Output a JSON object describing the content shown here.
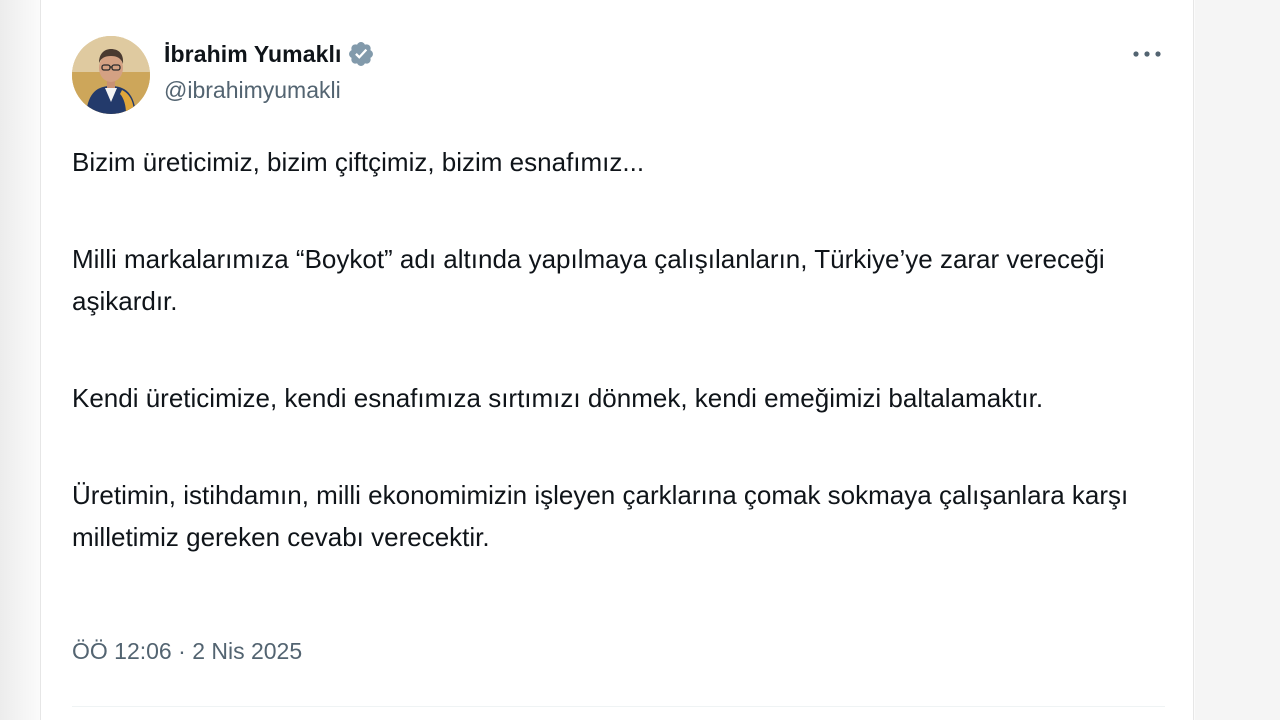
{
  "author": {
    "name": "İbrahim Yumaklı",
    "handle": "@ibrahimyumakli",
    "avatar_icon": "profile-photo",
    "verified_icon": "verified-badge-icon"
  },
  "colors": {
    "verified_badge": "#829aab",
    "text_primary": "#0f1419",
    "text_secondary": "#536471"
  },
  "tweet": {
    "paragraphs": [
      "Bizim üreticimiz, bizim çiftçimiz, bizim esnafımız...",
      "Milli markalarımıza “Boykot” adı altında yapılmaya çalışılanların, Türkiye’ye zarar vereceği aşikardır.",
      "Kendi üreticimize, kendi esnafımıza sırtımızı dönmek, kendi emeğimizi baltalamaktır.",
      "Üretimin, istihdamın, milli ekonomimizin işleyen çarklarına çomak sokmaya çalışanlara karşı milletimiz gereken cevabı verecektir."
    ],
    "time": "ÖÖ 12:06",
    "separator": "·",
    "date": "2 Nis 2025"
  },
  "menu": {
    "more_icon": "more-horizontal-icon"
  }
}
